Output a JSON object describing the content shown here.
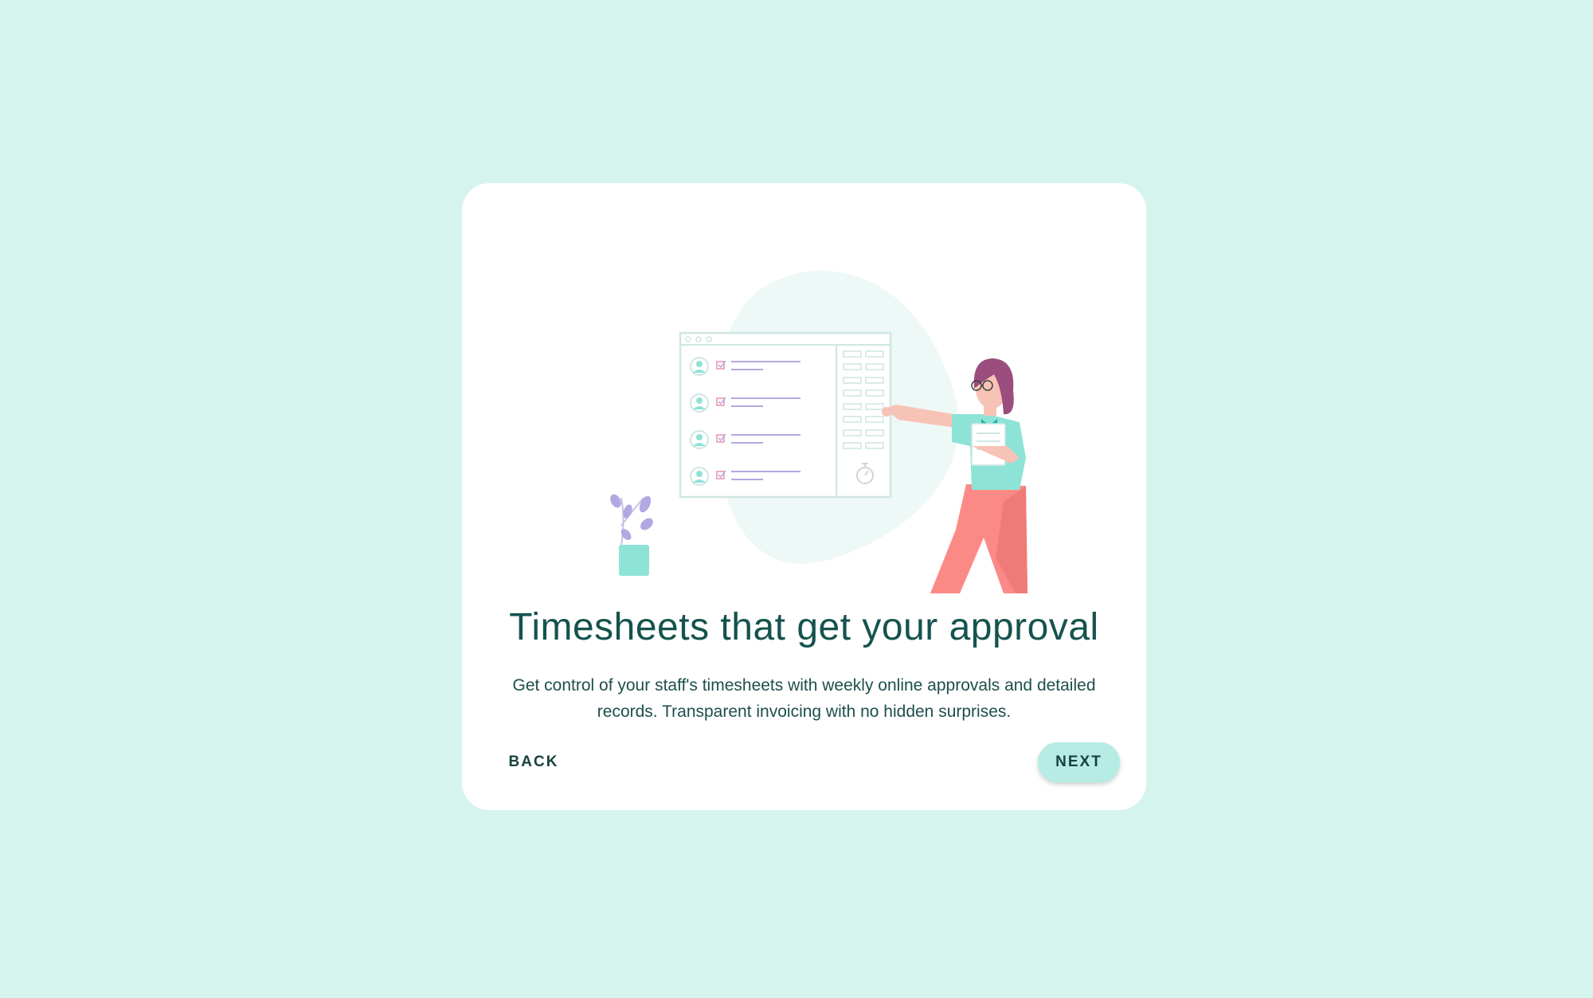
{
  "colors": {
    "background": "#d5f4ee",
    "card": "#ffffff",
    "title": "#15534e",
    "text": "#1d4f4b",
    "next_button": "#b6ece3",
    "accent_teal": "#8ee3d7",
    "accent_pink": "#fb8a87",
    "accent_purple": "#b3a8e2"
  },
  "onboarding": {
    "title": "Timesheets that get your approval",
    "description_line1": "Get control of your staff's timesheets with weekly online approvals and detailed",
    "description_line2": "records. Transparent invoicing with no hidden surprises.",
    "back_label": "BACK",
    "next_label": "NEXT"
  },
  "illustration": {
    "icons": [
      "timesheet-window-icon",
      "plant-icon",
      "person-icon",
      "stopwatch-icon"
    ]
  }
}
